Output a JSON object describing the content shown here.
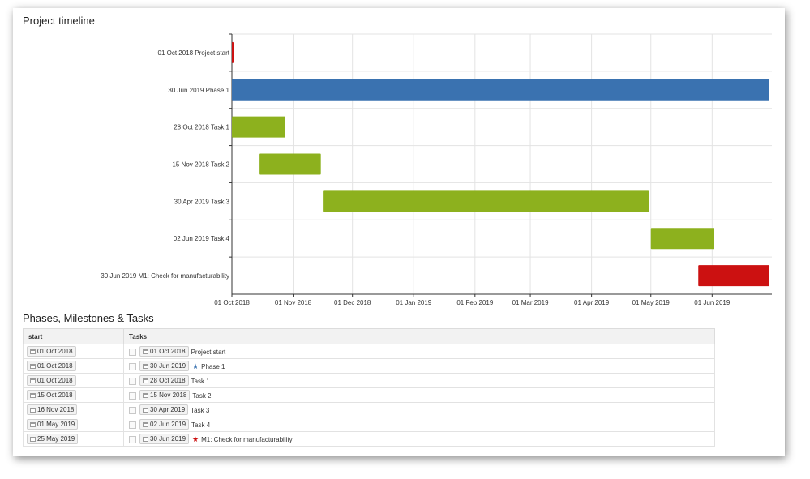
{
  "chart_title": "Project timeline",
  "table_title": "Phases, Milestones & Tasks",
  "colors": {
    "phase": "#3a72b0",
    "task": "#8db11e",
    "milestone": "#cc1111",
    "grid": "#e3e3e3",
    "axis": "#333333"
  },
  "chart_data": {
    "type": "gantt",
    "title": "Project timeline",
    "x_axis": {
      "type": "date",
      "range": [
        "2018-10-01",
        "2019-06-30"
      ],
      "ticks": [
        {
          "date": "2018-10-01",
          "label": "01 Oct 2018"
        },
        {
          "date": "2018-11-01",
          "label": "01 Nov 2018"
        },
        {
          "date": "2018-12-01",
          "label": "01 Dec 2018"
        },
        {
          "date": "2019-01-01",
          "label": "01 Jan 2019"
        },
        {
          "date": "2019-02-01",
          "label": "01 Feb 2019"
        },
        {
          "date": "2019-03-01",
          "label": "01 Mar 2019"
        },
        {
          "date": "2019-04-01",
          "label": "01 Apr 2019"
        },
        {
          "date": "2019-05-01",
          "label": "01 May 2019"
        },
        {
          "date": "2019-06-01",
          "label": "01 Jun 2019"
        }
      ],
      "grid": true
    },
    "rows": [
      {
        "label": "01 Oct 2018 Project start",
        "start": "2018-10-01",
        "end": "2018-10-01",
        "kind": "milestone"
      },
      {
        "label": "30 Jun 2019 Phase 1",
        "start": "2018-10-01",
        "end": "2019-06-30",
        "kind": "phase"
      },
      {
        "label": "28 Oct 2018 Task 1",
        "start": "2018-10-01",
        "end": "2018-10-28",
        "kind": "task"
      },
      {
        "label": "15 Nov 2018 Task 2",
        "start": "2018-10-15",
        "end": "2018-11-15",
        "kind": "task"
      },
      {
        "label": "30 Apr 2019 Task 3",
        "start": "2018-11-16",
        "end": "2019-04-30",
        "kind": "task"
      },
      {
        "label": "02 Jun 2019 Task 4",
        "start": "2019-05-01",
        "end": "2019-06-02",
        "kind": "task"
      },
      {
        "label": "30 Jun 2019 M1: Check for manufacturability",
        "start": "2019-05-25",
        "end": "2019-06-30",
        "kind": "milestone"
      }
    ]
  },
  "table": {
    "headers": {
      "start": "start",
      "tasks": "Tasks"
    },
    "rows": [
      {
        "start": "01 Oct 2018",
        "end": "01 Oct 2018",
        "name": "Project start",
        "star": ""
      },
      {
        "start": "01 Oct 2018",
        "end": "30 Jun 2019",
        "name": "Phase 1",
        "star": "blue-star-icon"
      },
      {
        "start": "01 Oct 2018",
        "end": "28 Oct 2018",
        "name": "Task 1",
        "star": ""
      },
      {
        "start": "15 Oct 2018",
        "end": "15 Nov 2018",
        "name": "Task 2",
        "star": ""
      },
      {
        "start": "16 Nov 2018",
        "end": "30 Apr 2019",
        "name": "Task 3",
        "star": ""
      },
      {
        "start": "01 May 2019",
        "end": "02 Jun 2019",
        "name": "Task 4",
        "star": ""
      },
      {
        "start": "25 May 2019",
        "end": "30 Jun 2019",
        "name": "M1: Check for manufacturability",
        "star": "red-star-icon"
      }
    ]
  }
}
